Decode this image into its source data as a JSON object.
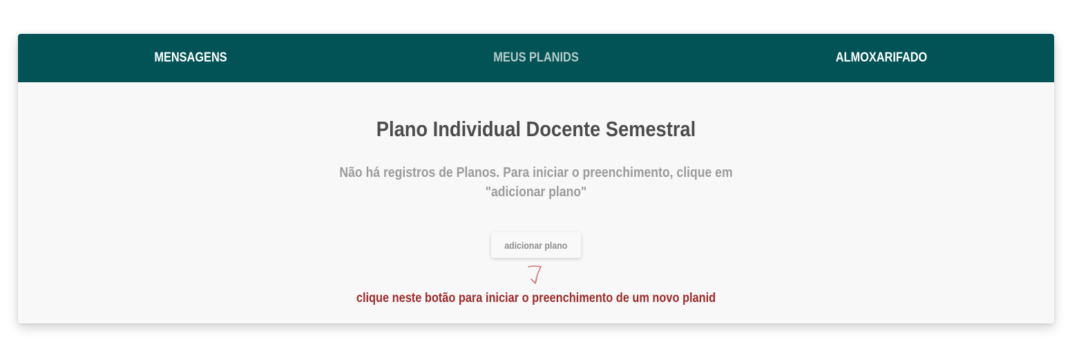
{
  "nav": {
    "tabs": [
      {
        "label": "MENSAGENS",
        "active": false
      },
      {
        "label": "MEUS PLANIDS",
        "active": true
      },
      {
        "label": "ALMOXARIFADO",
        "active": false
      }
    ],
    "background_color": "#025356"
  },
  "main": {
    "title": "Plano Individual Docente Semestral",
    "empty_message": "Não há registros de Planos. Para iniciar o preenchimento, clique em \"adicionar plano\"",
    "add_button_label": "adicionar plano",
    "hint_text": "clique neste botão para iniciar o preenchimento de um novo planid",
    "hint_color": "#9c2a2a",
    "arrow_icon": "hand-drawn-arrow-down-icon"
  }
}
